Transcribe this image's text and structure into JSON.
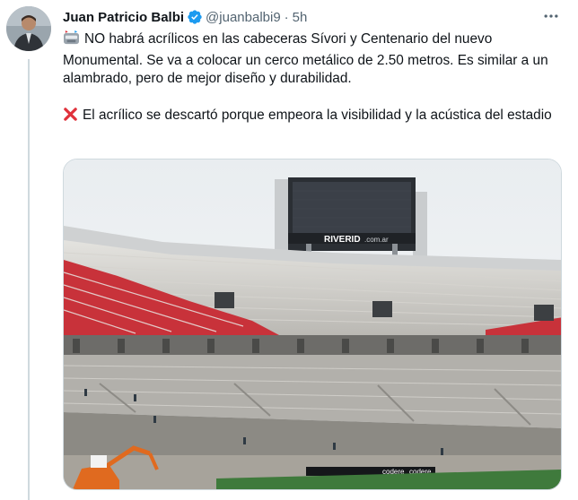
{
  "tweet": {
    "author_name": "Juan Patricio Balbi",
    "handle": "@juanbalbi9",
    "separator": "·",
    "time": "5h",
    "avatar_icon": "avatar-photo",
    "verified_icon": "verified-badge-icon",
    "more_icon": "more-options-icon",
    "paragraph1": "NO habrá acrílicos en las cabeceras Sívori y Centenario del nuevo Monumental. Se va a colocar un cerco metálico de 2.50 metros. Es similar a un alambrado, pero de mejor diseño y durabilidad.",
    "paragraph1_icon": "stadium-emoji",
    "paragraph2": "El acrílico se descartó porque empeora la visibilidad y la acústica del estadio",
    "paragraph2_icon": "cross-mark-emoji"
  },
  "media": {
    "scoreboard_brand": "RIVERID",
    "scoreboard_domain": ".com.ar",
    "ad_boards": [
      "codere",
      "codere"
    ]
  },
  "colors": {
    "accent": "#1d9bf0",
    "text": "#0f1419",
    "muted": "#536471",
    "cross": "#e0313b",
    "seat_red": "#c8323a"
  }
}
